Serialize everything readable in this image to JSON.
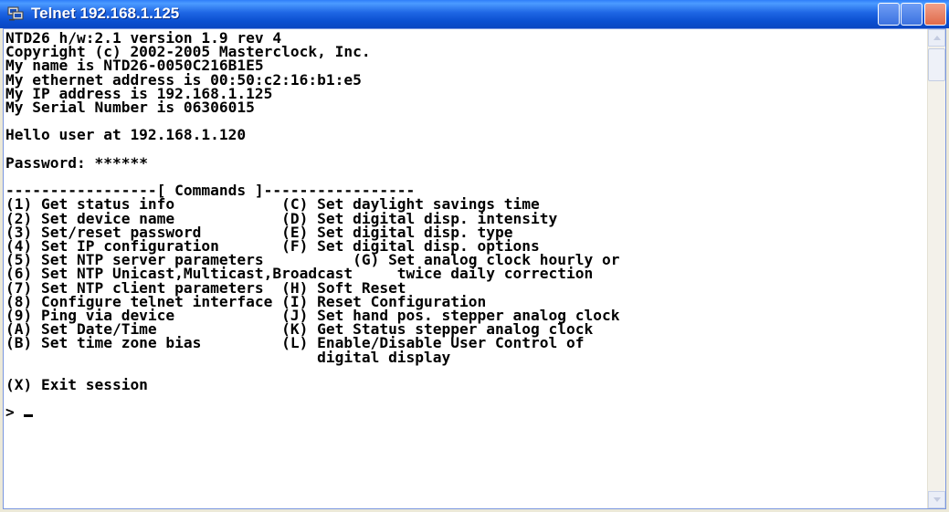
{
  "window": {
    "title": "Telnet 192.168.1.125",
    "icon": "telnet-computer-icon",
    "controls": [
      "minimize-icon",
      "maximize-icon",
      "close-icon"
    ]
  },
  "terminal": {
    "banner": [
      "NTD26 h/w:2.1 version 1.9 rev 4",
      "Copyright (c) 2002-2005 Masterclock, Inc.",
      "My name is NTD26-0050C216B1E5",
      "My ethernet address is 00:50:c2:16:b1:e5",
      "My IP address is 192.168.1.125",
      "My Serial Number is 06306015"
    ],
    "greeting": "Hello user at 192.168.1.120",
    "password_label": "Password:",
    "password_mask": "******",
    "commands_header": "-----------------[ Commands ]-----------------",
    "commands": [
      "(1) Get status info            (C) Set daylight savings time",
      "(2) Set device name            (D) Set digital disp. intensity",
      "(3) Set/reset password         (E) Set digital disp. type",
      "(4) Set IP configuration       (F) Set digital disp. options",
      "(5) Set NTP server parameters          (G) Set analog clock hourly or",
      "(6) Set NTP Unicast,Multicast,Broadcast     twice daily correction",
      "(7) Set NTP client parameters  (H) Soft Reset",
      "(8) Configure telnet interface (I) Reset Configuration",
      "(9) Ping via device            (J) Set hand pos. stepper analog clock",
      "(A) Set Date/Time              (K) Get Status stepper analog clock",
      "(B) Set time zone bias         (L) Enable/Disable User Control of",
      "                                   digital display"
    ],
    "exit_option": "(X) Exit session",
    "prompt": "> "
  },
  "colors": {
    "titlebar": "#0b4fd0",
    "terminal_background": "#ffffff",
    "terminal_text": "#000000"
  }
}
